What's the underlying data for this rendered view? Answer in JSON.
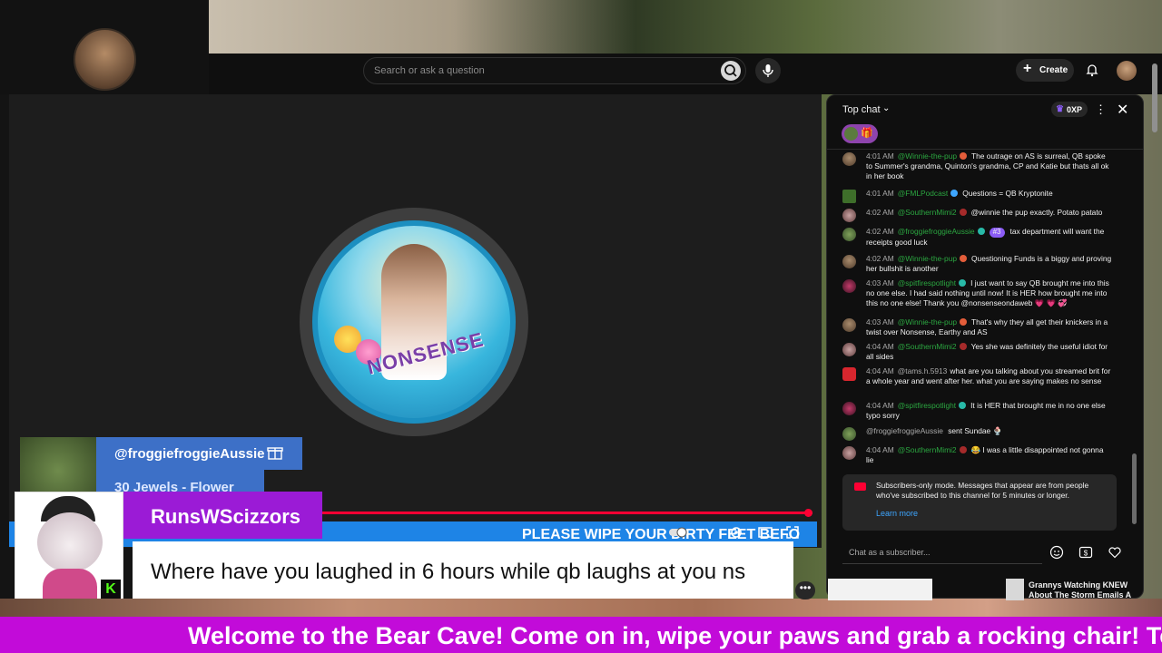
{
  "header": {
    "search_placeholder": "Search or ask a question",
    "create_label": "Create",
    "icons": [
      "search-icon",
      "mic-icon",
      "plus-icon",
      "bell-icon"
    ]
  },
  "video": {
    "logo_text": "NONSENSE",
    "alert": {
      "username": "@froggiefroggieAussie",
      "amount": "30 Jewels - Flower"
    },
    "ticker": "PLEASE WIPE YOUR DIRTY FEET BEFO",
    "progress_fraction": 0.99,
    "lower_third": {
      "name": "RunsWScizzors",
      "message": "Where have you laughed in 6 hours while qb laughs at you ns",
      "badge": "K"
    },
    "more_label": "•••"
  },
  "marquee": "Welcome to the Bear Cave! Come on in, wipe your paws and grab a rocking chair! Teddy be",
  "chat": {
    "title": "Top chat",
    "xp": "0XP",
    "close": "✕",
    "messages": [
      {
        "time": "4:01 AM",
        "user": "@Winnie-the-pup",
        "text": "The outrage on AS is surreal, QB spoke to Summer's grandma, Quinton's grandma, CP and Katie but thats all ok in her book"
      },
      {
        "time": "4:01 AM",
        "user": "@FMLPodcast",
        "text": "Questions = QB Kryptonite"
      },
      {
        "time": "4:02 AM",
        "user": "@SouthernMimi2",
        "text": "@winnie the pup exactly. Potato patato"
      },
      {
        "time": "4:02 AM",
        "user": "@froggiefroggieAussie",
        "rank": "#3",
        "text": "tax department will want the receipts good luck"
      },
      {
        "time": "4:02 AM",
        "user": "@Winnie-the-pup",
        "text": "Questioning Funds is a biggy and proving her bullshit is another"
      },
      {
        "time": "4:03 AM",
        "user": "@spitfirespotlight",
        "text": "I just want to say QB brought me into this no one else. I had said nothing until now! It is HER how brought me into this no one else! Thank you @nonsenseondaweb 💗 💗 💞"
      },
      {
        "time": "4:03 AM",
        "user": "@Winnie-the-pup",
        "text": "That's why they all get their knickers in a twist over Nonsense, Earthy and AS"
      },
      {
        "time": "4:04 AM",
        "user": "@SouthernMimi2",
        "text": "Yes she was definitely the useful idiot for all sides"
      },
      {
        "time": "4:04 AM",
        "user": "@tams.h.5913",
        "text": "what are you talking about you streamed brit for a whole year and went after her. what you are saying makes no sense"
      },
      {
        "time": "4:04 AM",
        "user": "@spitfirespotlight",
        "text": "It is HER that brought me in no one else typo sorry"
      },
      {
        "time": "",
        "user": "@froggiefroggieAussie",
        "text": "sent Sundae"
      },
      {
        "time": "4:04 AM",
        "user": "@SouthernMimi2",
        "text": "😂 I was a little disappointed not gonna lie"
      }
    ],
    "subscribers_notice": "Subscribers-only mode. Messages that appear are from people who've subscribed to this channel for 5 minutes or longer.",
    "learn_more": "Learn more",
    "input_placeholder": "Chat as a subscriber..."
  },
  "suggestion": {
    "title": "Grannys Watching KNEW About The Storm Emails A"
  },
  "colors": {
    "accent_red": "#ff0033",
    "ticker_blue": "#1e84e6",
    "marquee_purple": "#c20bd9",
    "lower_third_purple": "#9b1bd6",
    "chat_username_green": "#2ba640"
  }
}
